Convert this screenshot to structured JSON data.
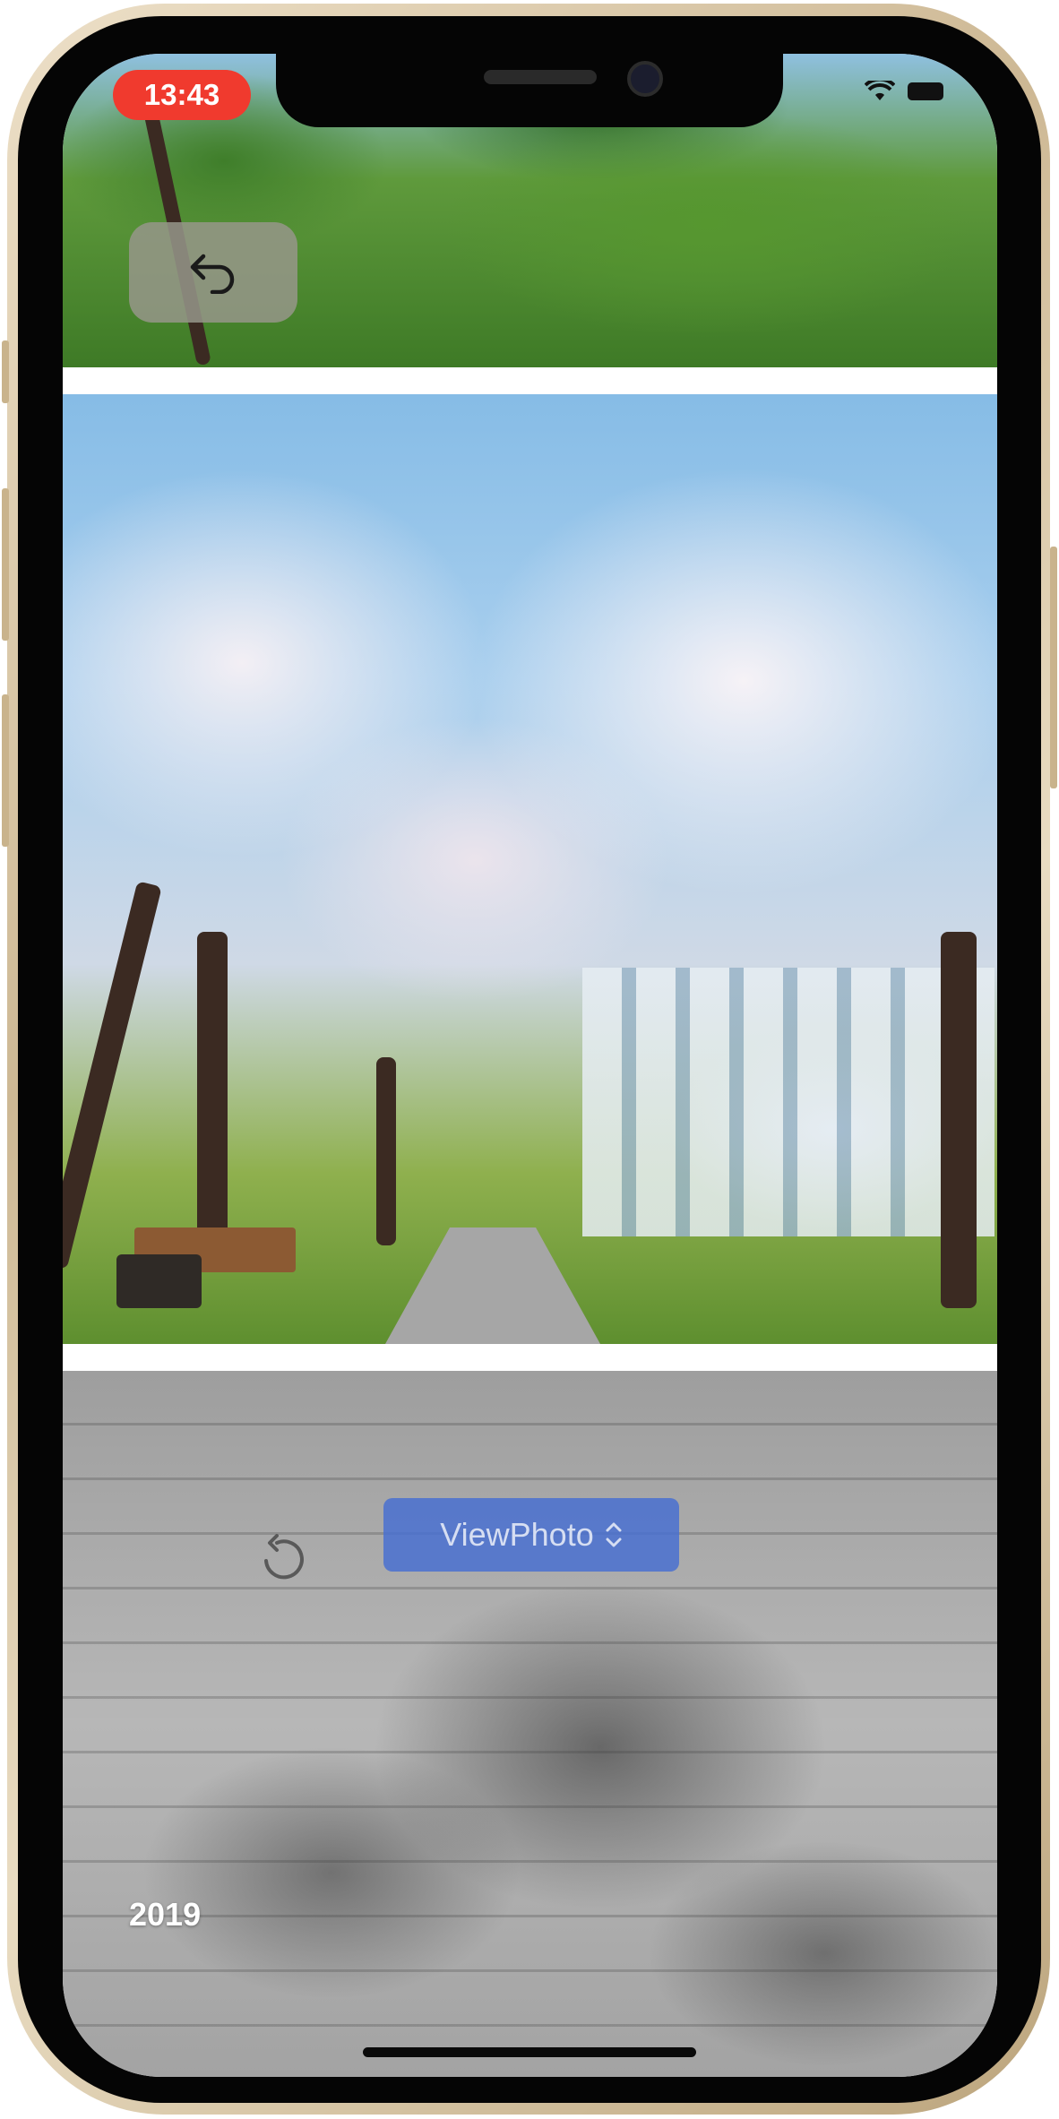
{
  "status_bar": {
    "time": "13:43"
  },
  "navigation": {
    "back_icon": "undo-arrow-icon"
  },
  "photos": [
    {
      "name": "trees-overhead"
    },
    {
      "name": "cherry-blossom-path"
    },
    {
      "name": "boardwalk-shadows"
    }
  ],
  "controls": {
    "rotate_icon": "rotate-counterclockwise-icon",
    "picker_label": "ViewPhoto",
    "picker_icon": "up-down-chevron-icon"
  },
  "caption": {
    "year": "2019"
  },
  "colors": {
    "time_pill": "#f03a2e",
    "picker_background": "#466ed2",
    "back_button": "#96968a"
  }
}
